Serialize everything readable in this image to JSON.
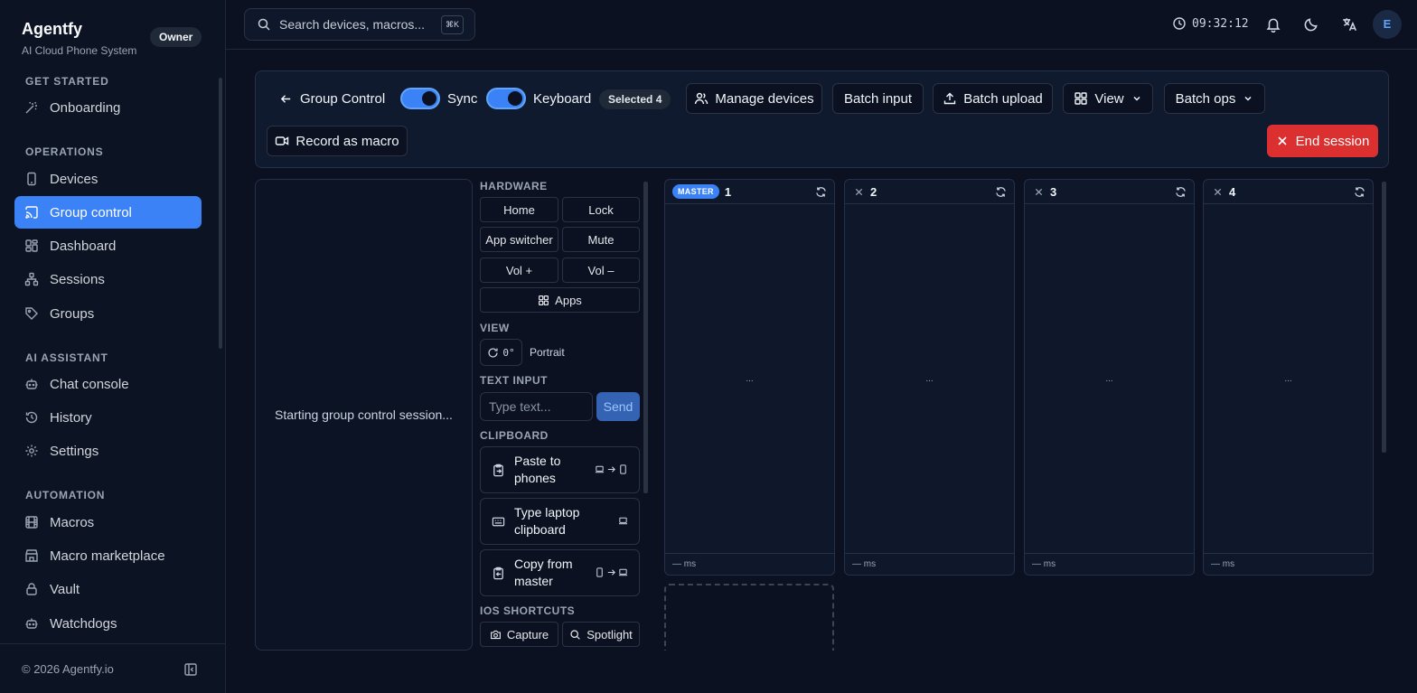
{
  "brand": {
    "name": "Agentfy",
    "subtitle": "AI Cloud Phone System",
    "role_badge": "Owner"
  },
  "sidebar": {
    "sections": [
      {
        "title": "GET STARTED",
        "items": [
          {
            "label": "Onboarding",
            "icon": "magic-wand-icon"
          }
        ]
      },
      {
        "title": "OPERATIONS",
        "items": [
          {
            "label": "Devices",
            "icon": "smartphone-icon"
          },
          {
            "label": "Group control",
            "icon": "cast-icon",
            "active": true
          },
          {
            "label": "Dashboard",
            "icon": "dashboard-grid-icon"
          },
          {
            "label": "Sessions",
            "icon": "network-icon"
          },
          {
            "label": "Groups",
            "icon": "tag-icon"
          }
        ]
      },
      {
        "title": "AI ASSISTANT",
        "items": [
          {
            "label": "Chat console",
            "icon": "bot-icon"
          },
          {
            "label": "History",
            "icon": "history-icon"
          },
          {
            "label": "Settings",
            "icon": "gear-icon"
          }
        ]
      },
      {
        "title": "AUTOMATION",
        "items": [
          {
            "label": "Macros",
            "icon": "film-icon"
          },
          {
            "label": "Macro marketplace",
            "icon": "store-icon"
          },
          {
            "label": "Vault",
            "icon": "lock-icon"
          },
          {
            "label": "Watchdogs",
            "icon": "bot-icon"
          }
        ]
      }
    ],
    "footer": "© 2026 Agentfy.io"
  },
  "topbar": {
    "search_placeholder": "Search devices, macros...",
    "shortcut": "⌘K",
    "time": "09:32:12",
    "avatar_initial": "E"
  },
  "toolbar": {
    "back_label": "Group Control",
    "sync_label": "Sync",
    "keyboard_label": "Keyboard",
    "selected_badge": "Selected 4",
    "manage_devices": "Manage devices",
    "batch_input": "Batch input",
    "batch_upload": "Batch upload",
    "view": "View",
    "batch_ops": "Batch ops",
    "record_macro": "Record as macro",
    "end_session": "End session"
  },
  "preview": {
    "status": "Starting group control session..."
  },
  "panel": {
    "hardware_title": "HARDWARE",
    "hardware": [
      "Home",
      "Lock",
      "App switcher",
      "Mute",
      "Vol +",
      "Vol –"
    ],
    "apps": "Apps",
    "view_title": "VIEW",
    "rotation": "0°",
    "orientation": "Portrait",
    "text_title": "TEXT INPUT",
    "text_placeholder": "Type text...",
    "send": "Send",
    "clipboard_title": "CLIPBOARD",
    "clipboard": [
      "Paste to phones",
      "Type laptop clipboard",
      "Copy from master"
    ],
    "ios_title": "IOS SHORTCUTS",
    "ios": [
      "Capture",
      "Spotlight"
    ]
  },
  "devices": [
    {
      "num": "1",
      "master": true,
      "badge": "MASTER",
      "body": "...",
      "latency": "— ms"
    },
    {
      "num": "2",
      "master": false,
      "body": "...",
      "latency": "— ms"
    },
    {
      "num": "3",
      "master": false,
      "body": "...",
      "latency": "— ms"
    },
    {
      "num": "4",
      "master": false,
      "body": "...",
      "latency": "— ms"
    }
  ]
}
